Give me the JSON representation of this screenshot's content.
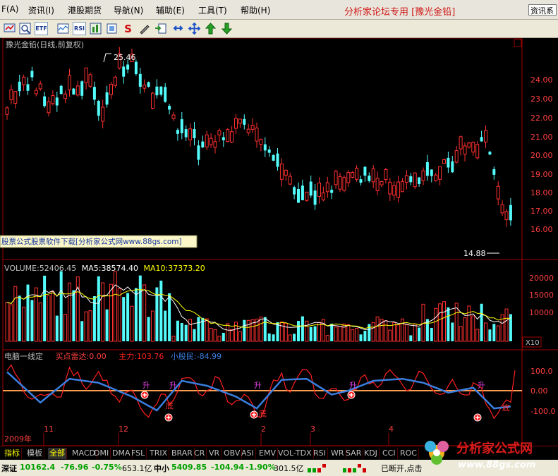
{
  "menu": {
    "items": [
      "F(A)",
      "资讯(I)",
      "港股期货",
      "导航(N)",
      "辅助(E)",
      "工具(T)",
      "帮助(H)"
    ],
    "title": "分析家论坛专用 [豫光金铅]",
    "search": "资讯系"
  },
  "toolbar": {
    "buttons": [
      "display-icon",
      "search-icon",
      "ETF",
      "grid-icon",
      "RSI",
      "chart-icon",
      "stock-icon",
      "S",
      "tools-icon",
      "import-icon",
      "pan-icon",
      "move-icon",
      "up-arrow-icon",
      "down-arrow-icon"
    ]
  },
  "colors": {
    "up": "#ff3030",
    "down": "#54fcfc",
    "axis": "#c00000",
    "ma5": "#ffffff",
    "ma10": "#ffff00",
    "main_force": "#ff2020",
    "retail": "#3a7fe0",
    "level": "#ff9e50"
  },
  "price_panel": {
    "title": "豫光金铅(日线,前复权)",
    "high_label": "25.46",
    "low_label": "14.88",
    "y_ticks": [
      "24.00",
      "23.00",
      "22.00",
      "21.00",
      "20.00",
      "19.00",
      "18.00",
      "17.00",
      "16.00"
    ],
    "banner": "股票公式股票软件下载[分析家公式网www.88gs.com]"
  },
  "volume_panel": {
    "label_volume": "VOLUME:52406.45",
    "label_ma5": "MA5:38574.40",
    "label_ma10": "MA10:37373.20",
    "y_ticks": [
      "20000",
      "15000",
      "10000"
    ],
    "unit": "X10"
  },
  "indicator_panel": {
    "name": "电脑一线定",
    "buy_label": "买点雷达:0.00",
    "main_force_label": "主力:103.76",
    "retail_label": "小股民:-84.99",
    "y_ticks": [
      "100.0",
      "0.00",
      "-100.0"
    ],
    "marks": {
      "rise": "升",
      "bottom": "底"
    }
  },
  "x_axis": {
    "labels": [
      "2009年",
      "11",
      "12",
      "2",
      "3",
      "4"
    ]
  },
  "bottom_tabs": [
    "指标",
    "模板",
    "全部",
    "MACD",
    "DMI",
    "DMA",
    "FSL",
    "TRIX",
    "BRAR",
    "CR",
    "VR",
    "OBV",
    "ASI",
    "EMV",
    "VOL-TDX",
    "RSI",
    "WR",
    "SAR",
    "KDJ",
    "CCI",
    "ROC"
  ],
  "status": {
    "sz_label": "深证",
    "sz_value": "10162.4",
    "sz_change": "-76.96",
    "sz_pct": "-0.75%",
    "sz_amount": "653.1亿",
    "sm_label": "中小",
    "sm_value": "5409.85",
    "sm_change": "-104.94",
    "sm_pct": "-1.90%",
    "sm_amount": "301.5亿",
    "message": "已断开,点击"
  },
  "watermark": {
    "name": "分析家公式网",
    "url": "www.88gs.com"
  },
  "chart_data": {
    "type": "candlestick",
    "title": "豫光金铅(日线,前复权)",
    "ylim": [
      14.5,
      25.8
    ],
    "highest": 25.46,
    "lowest": 14.88,
    "x_labels": [
      "2009年",
      "11",
      "12",
      "2",
      "3",
      "4"
    ],
    "volume_ticks": [
      20000,
      15000,
      10000
    ],
    "indicator_ticks": [
      100,
      0,
      -100
    ],
    "latest": {
      "volume": 52406.45,
      "ma5": 38574.4,
      "ma10": 37373.2,
      "main_force": 103.76,
      "retail": -84.99,
      "buy_radar": 0.0
    }
  }
}
